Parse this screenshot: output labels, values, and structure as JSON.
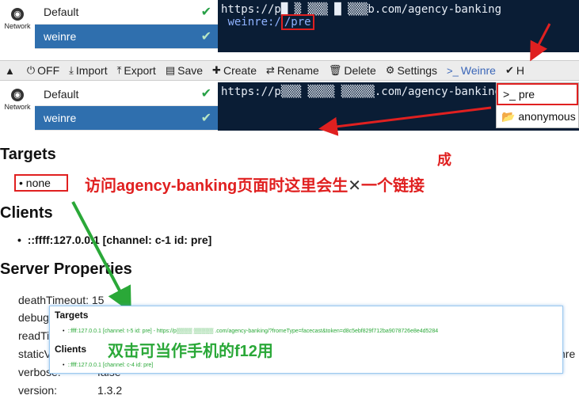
{
  "top_panel": {
    "network_label": "Network",
    "profiles": [
      {
        "label": "Default",
        "active": false
      },
      {
        "label": "weinre",
        "active": true
      }
    ],
    "terminal_url": "https://p█ ▒ ▒▒▒ █ ▒▒▒b.com/agency-banking",
    "terminal_cmd_prefix": "weinre:/",
    "terminal_cmd_highlight": "/pre"
  },
  "toolbar": {
    "items": [
      {
        "icon": "chevron-up",
        "glyph": "▲",
        "label": ""
      },
      {
        "icon": "power-icon",
        "glyph": "⏻",
        "label": "OFF"
      },
      {
        "icon": "import-icon",
        "glyph": "⤓",
        "label": "Import"
      },
      {
        "icon": "export-icon",
        "glyph": "⤒",
        "label": "Export"
      },
      {
        "icon": "save-icon",
        "glyph": "▤",
        "label": "Save"
      },
      {
        "icon": "plus-icon",
        "glyph": "✚",
        "label": "Create"
      },
      {
        "icon": "rename-icon",
        "glyph": "⇄",
        "label": "Rename"
      },
      {
        "icon": "trash-icon",
        "glyph": "🗑",
        "label": "Delete"
      },
      {
        "icon": "gear-icon",
        "glyph": "⚙",
        "label": "Settings"
      },
      {
        "icon": "terminal-icon",
        "glyph": ">_",
        "label": "Weinre"
      },
      {
        "icon": "check-icon",
        "glyph": "✔",
        "label": "H"
      }
    ]
  },
  "second_panel": {
    "network_label": "Network",
    "profiles": [
      {
        "label": "Default",
        "active": false
      },
      {
        "label": "weinre",
        "active": true
      }
    ],
    "terminal_url": "https://p▒▒▒ ▒▒▒▒  ▒▒▒▒▒.com/agency-banking",
    "dropdown": [
      {
        "glyph": ">_",
        "label": "pre",
        "selected": true
      },
      {
        "glyph": "📂",
        "label": "anonymous",
        "selected": false
      }
    ]
  },
  "content": {
    "targets_heading": "Targets",
    "targets_item": "none",
    "clients_heading": "Clients",
    "client_item": "::ffff:127.0.0.1 [channel: c-1 id: pre]",
    "server_heading": "Server Properties",
    "properties": [
      {
        "key": "deathTimeout:",
        "value": "15"
      },
      {
        "key": "debug",
        "value": ""
      },
      {
        "key": "readTi",
        "value": ""
      },
      {
        "key": "staticV",
        "value": ""
      },
      {
        "key": "verbose:",
        "value": "false"
      },
      {
        "key": "version:",
        "value": "1.3.2"
      }
    ],
    "overflow_text": "nre"
  },
  "annotations": {
    "red_note": "访问agency-banking页面时这里会生",
    "red_note_tail": "一个链接",
    "red_small": "成",
    "green_note": "双击可当作手机的f12用"
  },
  "popup": {
    "targets_heading": "Targets",
    "targets_line": "::ffff:127.0.0.1 [channel: t-5 id: pre] - https://p▒▒▒▒ ▒▒▒▒▒ .com/agency-banking/?fromeType=facecast&token=d8c5ebf829f712ba9078726e8e4d5284",
    "clients_heading": "Clients",
    "clients_line": "::ffff:127.0.0.1 [channel: c-4 id: pre]"
  },
  "colors": {
    "accent_blue": "#2f6fae",
    "terminal_bg": "#0a1d35",
    "annotation_red": "#e02020",
    "annotation_green": "#2aa838"
  }
}
